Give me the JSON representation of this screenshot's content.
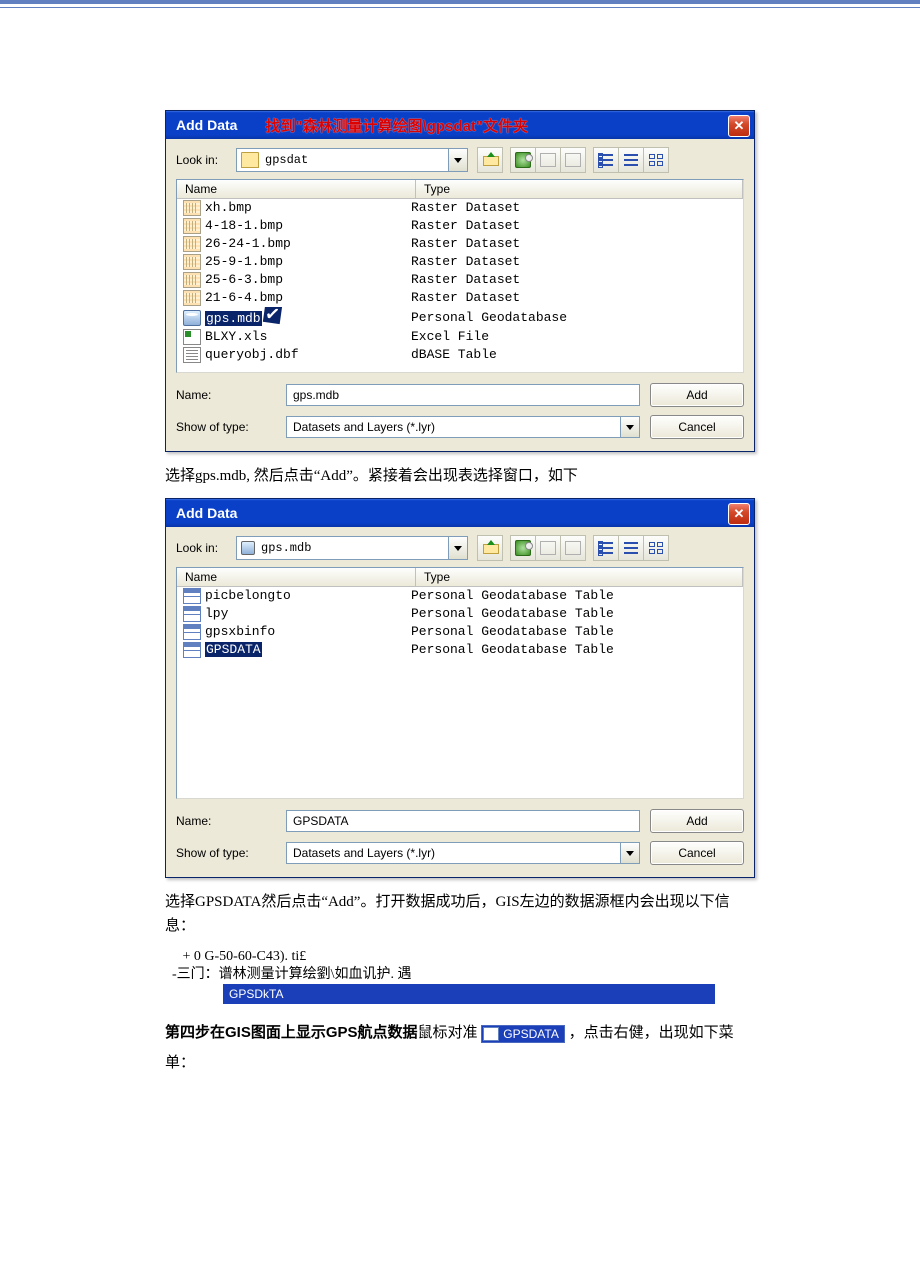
{
  "dialog1": {
    "title": "Add Data",
    "overlay": "找到\"森林测量计算绘图\\gpsdat\"文件夹",
    "lookin_label": "Look in:",
    "path": "gpsdat",
    "col_name": "Name",
    "col_type": "Type",
    "files": [
      {
        "name": "xh.bmp",
        "type": "Raster Dataset",
        "icon": "raster"
      },
      {
        "name": "4-18-1.bmp",
        "type": "Raster Dataset",
        "icon": "raster"
      },
      {
        "name": "26-24-1.bmp",
        "type": "Raster Dataset",
        "icon": "raster"
      },
      {
        "name": "25-9-1.bmp",
        "type": "Raster Dataset",
        "icon": "raster"
      },
      {
        "name": "25-6-3.bmp",
        "type": "Raster Dataset",
        "icon": "raster"
      },
      {
        "name": "21-6-4.bmp",
        "type": "Raster Dataset",
        "icon": "raster"
      },
      {
        "name": "gps.mdb",
        "type": "Personal Geodatabase",
        "icon": "mdb",
        "selected": true,
        "mark": true
      },
      {
        "name": "BLXY.xls",
        "type": "Excel File",
        "icon": "xls"
      },
      {
        "name": "queryobj.dbf",
        "type": "dBASE Table",
        "icon": "dbf"
      }
    ],
    "name_label": "Name:",
    "name_value": "gps.mdb",
    "type_label": "Show of type:",
    "type_value": "Datasets and Layers (*.lyr)",
    "add": "Add",
    "cancel": "Cancel"
  },
  "para1": "选择gps.mdb, 然后点击“Add”。紧接着会出现表选择窗口，如下",
  "dialog2": {
    "title": "Add Data",
    "lookin_label": "Look in:",
    "path": "gps.mdb",
    "col_name": "Name",
    "col_type": "Type",
    "files": [
      {
        "name": "picbelongto",
        "type": "Personal Geodatabase Table",
        "icon": "table"
      },
      {
        "name": "lpy",
        "type": "Personal Geodatabase Table",
        "icon": "table"
      },
      {
        "name": "gpsxbinfo",
        "type": "Personal Geodatabase Table",
        "icon": "table"
      },
      {
        "name": "GPSDATA",
        "type": "Personal Geodatabase Table",
        "icon": "table",
        "selected": true
      }
    ],
    "name_label": "Name:",
    "name_value": "GPSDATA",
    "type_label": "Show of type:",
    "type_value": "Datasets and Layers (*.lyr)",
    "add": "Add",
    "cancel": "Cancel"
  },
  "para2": "选择GPSDATA然后点击“Add”。打开数据成功后，GIS左边的数据源框内会出现以下信息：",
  "tree": {
    "line1": "     + 0 G-50-60-C43). ti£",
    "line2": "  -三门：谱林测量计算绘劉\\如血讥护. 遇",
    "sel": "GPSDkTA"
  },
  "step4": {
    "prefix_bold": "第四步在GIS图面上显示GPS航点数据",
    "mid": "鼠标对准  ",
    "badge": "GPSDATA",
    "suffix": " ，点击右健，出现如下菜单："
  }
}
